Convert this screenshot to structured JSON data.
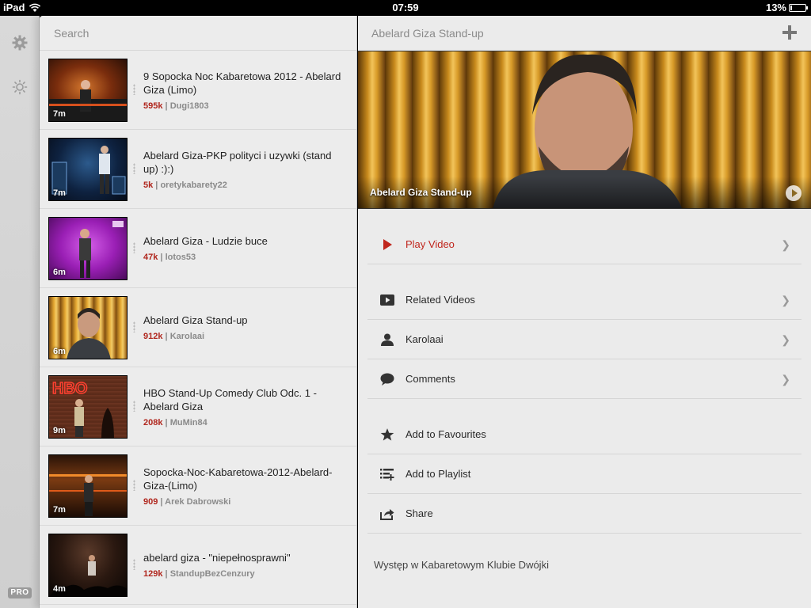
{
  "status_bar": {
    "device": "iPad",
    "time": "07:59",
    "battery": "13%",
    "battery_level": 0.13
  },
  "rail": {
    "settings_icon": "gear-icon",
    "brightness_icon": "brightness-icon",
    "pro_badge": "PRO"
  },
  "search": {
    "placeholder": "Search"
  },
  "videos": [
    {
      "title": "9 Sopocka Noc Kabaretowa 2012 - Abelard Giza (Limo)",
      "views": "595k",
      "author": "Dugi1803",
      "duration": "7m"
    },
    {
      "title": "Abelard Giza-PKP polityci i uzywki (stand up) :):)",
      "views": "5k",
      "author": "oretykabarety22",
      "duration": "7m"
    },
    {
      "title": "Abelard Giza - Ludzie buce",
      "views": "47k",
      "author": "lotos53",
      "duration": "6m"
    },
    {
      "title": "Abelard Giza Stand-up",
      "views": "912k",
      "author": "Karolaai",
      "duration": "6m"
    },
    {
      "title": "HBO Stand-Up Comedy Club Odc. 1 - Abelard Giza",
      "views": "208k",
      "author": "MuMin84",
      "duration": "9m"
    },
    {
      "title": "Sopocka-Noc-Kabaretowa-2012-Abelard-Giza-(Limo)",
      "views": "909",
      "author": "Arek Dabrowski",
      "duration": "7m"
    },
    {
      "title": "abelard giza - \"niepełnosprawni\"",
      "views": "129k",
      "author": "StandupBezCenzury",
      "duration": "4m"
    }
  ],
  "detail": {
    "title": "Abelard Giza Stand-up",
    "hero_caption": "Abelard Giza Stand-up",
    "play_video": "Play Video",
    "related_videos": "Related Videos",
    "author": "Karolaai",
    "comments": "Comments",
    "add_to_favourites": "Add to Favourites",
    "add_to_playlist": "Add to Playlist",
    "share": "Share",
    "chevron": "❯",
    "description": "Występ w Kabaretowym Klubie Dwójki"
  },
  "colors": {
    "accent": "#c0261d",
    "views": "#b0261d"
  }
}
